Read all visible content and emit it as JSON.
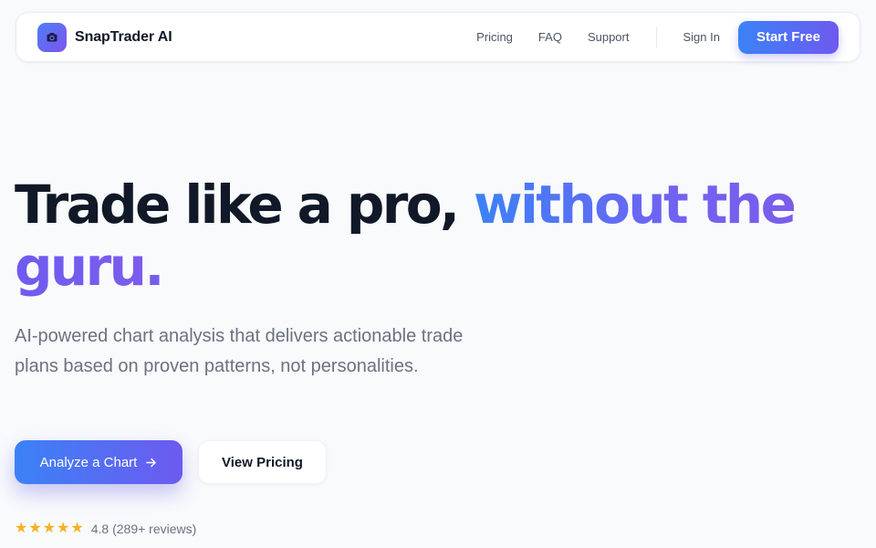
{
  "navbar": {
    "brand": "SnapTrader AI",
    "logo_icon": "camera-icon",
    "links": [
      "Pricing",
      "FAQ",
      "Support"
    ],
    "sign_in": "Sign In",
    "start_free": "Start Free"
  },
  "hero": {
    "headline_part1": "Trade like a pro",
    "headline_comma": ",",
    "headline_part2": "without the",
    "headline_part3": "guru",
    "headline_period": ".",
    "subtext": "AI-powered chart analysis that delivers actionable trade plans based on proven patterns, not personalities.",
    "cta_primary": "Analyze a Chart",
    "cta_primary_icon": "arrow-right-icon",
    "cta_secondary": "View Pricing"
  },
  "rating": {
    "stars": 5,
    "score": "4.8",
    "reviews": "(289+ reviews)"
  },
  "colors": {
    "accent_blue": "#3b82f6",
    "accent_purple": "#6d5af0",
    "star": "#f5b120",
    "background": "#f8fafc"
  }
}
